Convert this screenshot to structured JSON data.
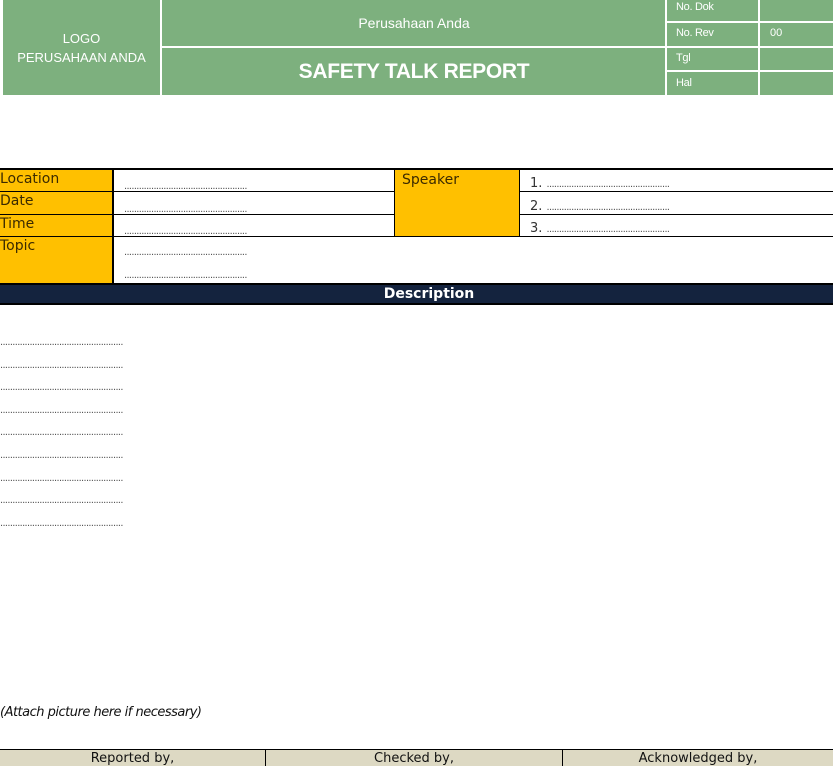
{
  "header": {
    "logo_line1": "LOGO",
    "logo_line2": "PERUSAHAAN ANDA",
    "company": "Perusahaan Anda",
    "title": "SAFETY TALK REPORT",
    "meta": [
      {
        "label": "No. Dok",
        "value": ""
      },
      {
        "label": "No. Rev",
        "value": "00"
      },
      {
        "label": "Tgl",
        "value": ""
      },
      {
        "label": "Hal",
        "value": ""
      }
    ]
  },
  "info": {
    "location_label": "Location",
    "date_label": "Date",
    "time_label": "Time",
    "topic_label": "Topic",
    "location_value": "..................................................",
    "date_value": "..................................................",
    "time_value": "..................................................",
    "topic_value1": "..................................................",
    "topic_value2": "..................................................",
    "speaker_label": "Speaker",
    "speakers": [
      {
        "num": "1.",
        "value": ".................................................."
      },
      {
        "num": "2.",
        "value": ".................................................."
      },
      {
        "num": "3.",
        "value": ".................................................."
      }
    ]
  },
  "description": {
    "heading": "Description",
    "lines": [
      "..................................................",
      "..................................................",
      "..................................................",
      "..................................................",
      "..................................................",
      "..................................................",
      "..................................................",
      "..................................................",
      ".................................................."
    ],
    "attach_note": "(Attach picture here if necessary)"
  },
  "signatures": {
    "reported_by": "Reported by,",
    "checked_by": "Checked by,",
    "acknowledged_by": "Acknowledged by,"
  },
  "colors": {
    "header_green": "#7db07e",
    "label_yellow": "#ffc000",
    "description_navy": "#14233e",
    "signature_beige": "#ddd9c3"
  }
}
